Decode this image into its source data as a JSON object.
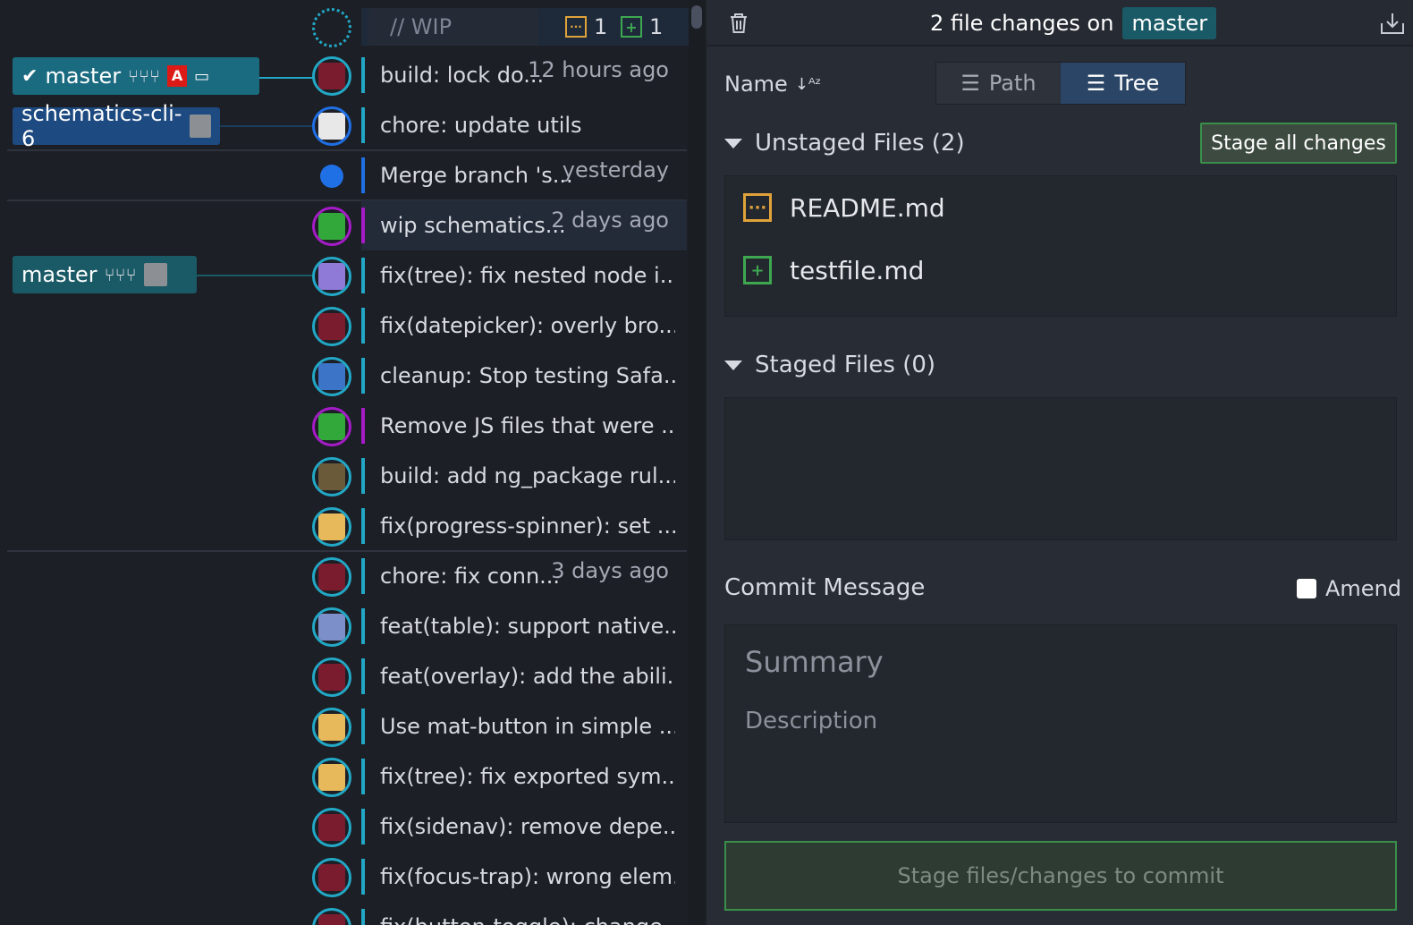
{
  "wip": {
    "label": "// WIP",
    "modified_count": "1",
    "added_count": "1"
  },
  "refs": {
    "master_head": "master",
    "schematics": "schematics-cli-6",
    "master_remote": "master"
  },
  "commits": [
    {
      "message": "build: lock do...",
      "time": "12 hours ago"
    },
    {
      "message": "chore: update utils",
      "time": ""
    },
    {
      "message": "Merge branch 's...",
      "time": "yesterday"
    },
    {
      "message": "wip schematics...",
      "time": "2 days ago"
    },
    {
      "message": "fix(tree): fix nested node i...",
      "time": ""
    },
    {
      "message": "fix(datepicker): overly bro...",
      "time": ""
    },
    {
      "message": "cleanup: Stop testing Safa...",
      "time": ""
    },
    {
      "message": "Remove JS files that were ...",
      "time": ""
    },
    {
      "message": "build: add ng_package rul...",
      "time": ""
    },
    {
      "message": "fix(progress-spinner): set ...",
      "time": ""
    },
    {
      "message": "chore: fix conn...",
      "time": "3 days ago"
    },
    {
      "message": "feat(table): support native...",
      "time": ""
    },
    {
      "message": "feat(overlay): add the abili...",
      "time": ""
    },
    {
      "message": "Use mat-button in simple ...",
      "time": ""
    },
    {
      "message": "fix(tree): fix exported sym...",
      "time": ""
    },
    {
      "message": "fix(sidenav): remove depe...",
      "time": ""
    },
    {
      "message": "fix(focus-trap): wrong elem...",
      "time": ""
    },
    {
      "message": "fix(button-toggle): change...",
      "time": ""
    }
  ],
  "panel": {
    "title_prefix": "2 file changes on",
    "branch": "master",
    "sort_label": "Name",
    "view_path": "Path",
    "view_tree": "Tree",
    "unstaged_heading": "Unstaged Files (2)",
    "stage_all": "Stage all changes",
    "unstaged_files": [
      {
        "name": "README.md",
        "status": "modified"
      },
      {
        "name": "testfile.md",
        "status": "added"
      }
    ],
    "staged_heading": "Staged Files (0)",
    "commit_heading": "Commit Message",
    "amend_label": "Amend",
    "summary_placeholder": "Summary",
    "description_placeholder": "Description",
    "commit_button": "Stage files/changes to commit"
  },
  "colors": {
    "accent_cyan": "#22a8c6",
    "accent_purple": "#a61bc8",
    "accent_blue": "#1f6fe5",
    "stage_green": "#3a8f4a",
    "modified_orange": "#e0a33a",
    "added_green": "#3ea851"
  }
}
